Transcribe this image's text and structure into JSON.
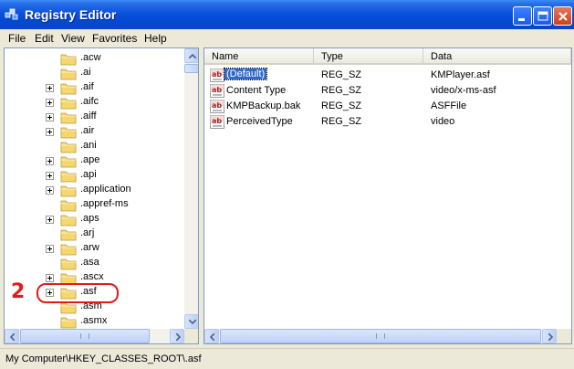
{
  "window": {
    "title": "Registry Editor"
  },
  "menu": [
    "File",
    "Edit",
    "View",
    "Favorites",
    "Help"
  ],
  "tree": {
    "items": [
      {
        "label": ".acw",
        "expandable": false
      },
      {
        "label": ".ai",
        "expandable": false
      },
      {
        "label": ".aif",
        "expandable": true
      },
      {
        "label": ".aifc",
        "expandable": true
      },
      {
        "label": ".aiff",
        "expandable": true
      },
      {
        "label": ".air",
        "expandable": true
      },
      {
        "label": ".ani",
        "expandable": false
      },
      {
        "label": ".ape",
        "expandable": true
      },
      {
        "label": ".api",
        "expandable": true
      },
      {
        "label": ".application",
        "expandable": true
      },
      {
        "label": ".appref-ms",
        "expandable": false
      },
      {
        "label": ".aps",
        "expandable": true
      },
      {
        "label": ".arj",
        "expandable": false
      },
      {
        "label": ".arw",
        "expandable": true
      },
      {
        "label": ".asa",
        "expandable": false
      },
      {
        "label": ".ascx",
        "expandable": true
      },
      {
        "label": ".asf",
        "expandable": true,
        "selected": true
      },
      {
        "label": ".asm",
        "expandable": false
      },
      {
        "label": ".asmx",
        "expandable": false
      }
    ]
  },
  "annotation": {
    "number": "2"
  },
  "list": {
    "columns": [
      "Name",
      "Type",
      "Data"
    ],
    "rows": [
      {
        "name": "(Default)",
        "type": "REG_SZ",
        "data": "KMPlayer.asf",
        "selected": true
      },
      {
        "name": "Content Type",
        "type": "REG_SZ",
        "data": "video/x-ms-asf"
      },
      {
        "name": "KMPBackup.bak",
        "type": "REG_SZ",
        "data": "ASFFile"
      },
      {
        "name": "PerceivedType",
        "type": "REG_SZ",
        "data": "video"
      }
    ]
  },
  "status": {
    "path": "My Computer\\HKEY_CLASSES_ROOT\\.asf"
  },
  "icons": {
    "app": "registry-editor-icon",
    "folder": "folder-icon",
    "value": "string-value-icon"
  },
  "colors": {
    "titlebar": "#0a52db",
    "selection": "#316ac5",
    "annotation": "#e21a1a",
    "folder": "#f6d66f"
  }
}
